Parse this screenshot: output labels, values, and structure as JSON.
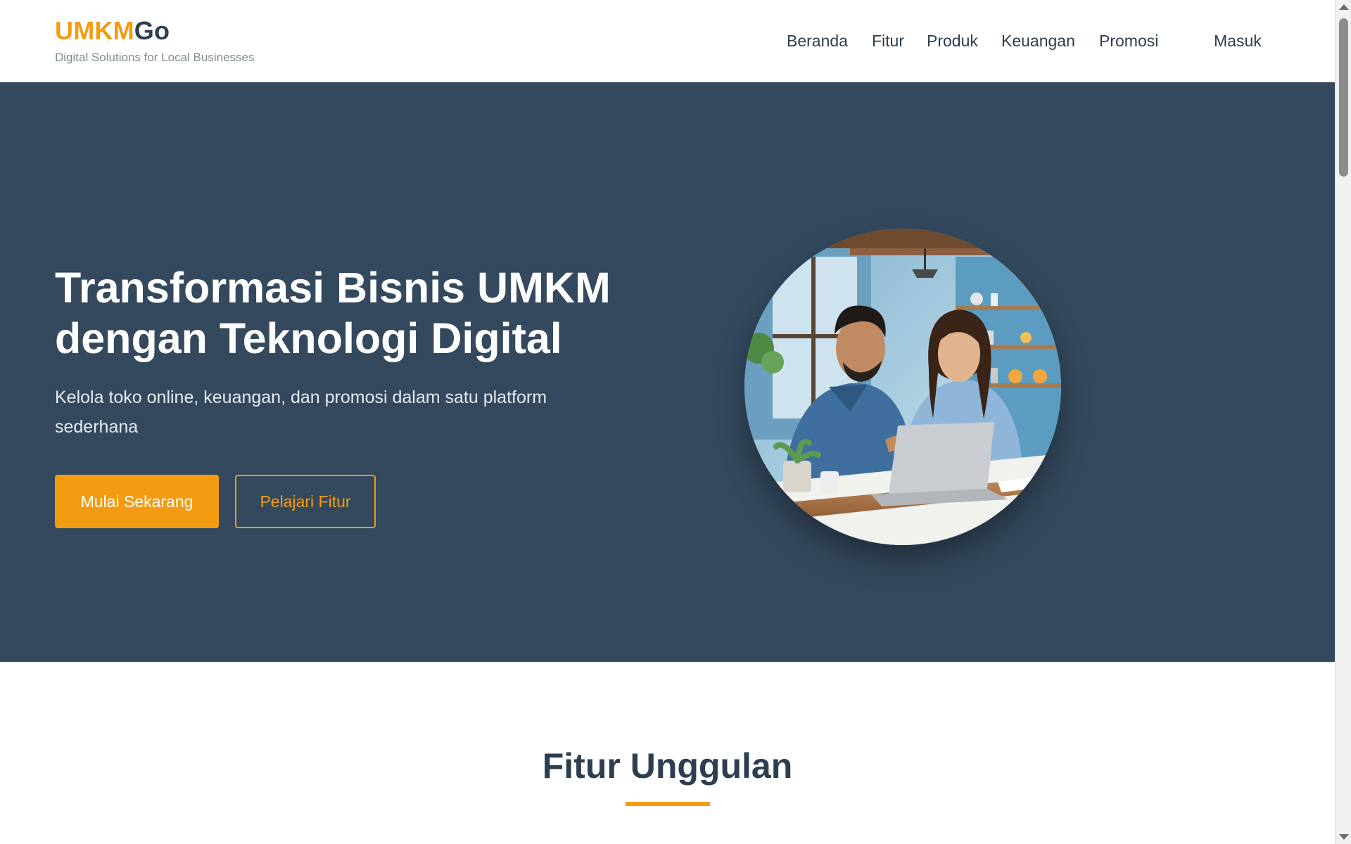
{
  "brand": {
    "name_part1": "UMKM",
    "name_part2": "Go",
    "tagline": "Digital Solutions for Local Businesses"
  },
  "nav": {
    "items": [
      {
        "label": "Beranda"
      },
      {
        "label": "Fitur"
      },
      {
        "label": "Produk"
      },
      {
        "label": "Keuangan"
      },
      {
        "label": "Promosi"
      },
      {
        "label": "Masuk"
      }
    ]
  },
  "hero": {
    "title": "Transformasi Bisnis UMKM dengan Teknologi Digital",
    "subtitle": "Kelola toko online, keuangan, dan promosi dalam satu platform sederhana",
    "primary_button": "Mulai Sekarang",
    "secondary_button": "Pelajari Fitur"
  },
  "features": {
    "title": "Fitur Unggulan"
  },
  "colors": {
    "accent": "#f39c12",
    "dark": "#2c3e50",
    "hero_bg": "#34495e",
    "muted": "#7f8c8d"
  }
}
